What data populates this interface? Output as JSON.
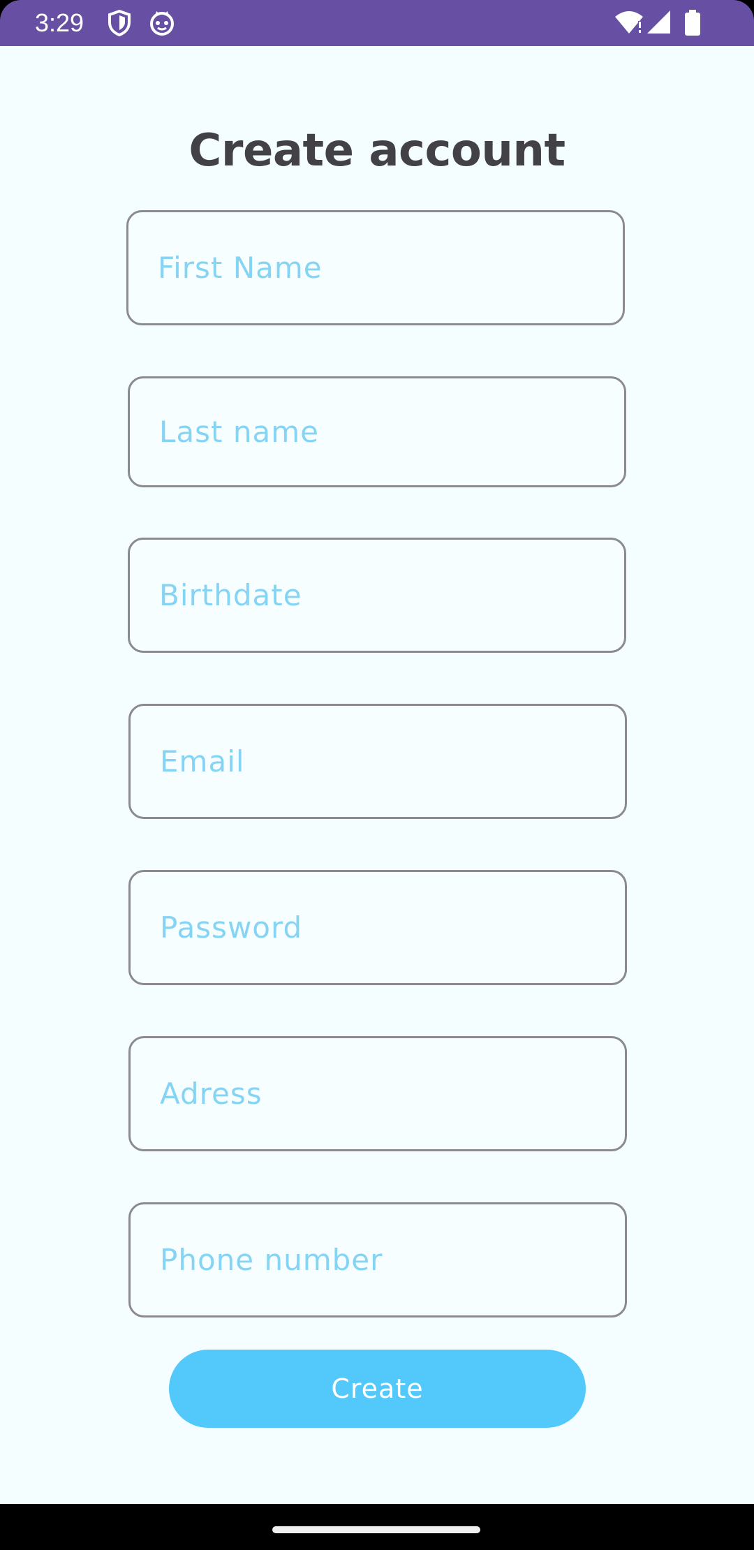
{
  "status_bar": {
    "time": "3:29",
    "icons": [
      "shield-icon",
      "cat-face-icon",
      "wifi-alert-icon",
      "cell-signal-icon",
      "battery-icon"
    ],
    "background": "#6750a4"
  },
  "form": {
    "title": "Create account",
    "fields": [
      {
        "placeholder": "First Name",
        "value": ""
      },
      {
        "placeholder": "Last name",
        "value": ""
      },
      {
        "placeholder": "Birthdate",
        "value": ""
      },
      {
        "placeholder": "Email",
        "value": ""
      },
      {
        "placeholder": "Password",
        "value": ""
      },
      {
        "placeholder": "Adress",
        "value": ""
      },
      {
        "placeholder": "Phone number",
        "value": ""
      }
    ],
    "submit_label": "Create"
  },
  "colors": {
    "accent": "#52c8fb",
    "placeholder": "#86d4f4",
    "title": "#424146",
    "background": "#f4fdff"
  }
}
